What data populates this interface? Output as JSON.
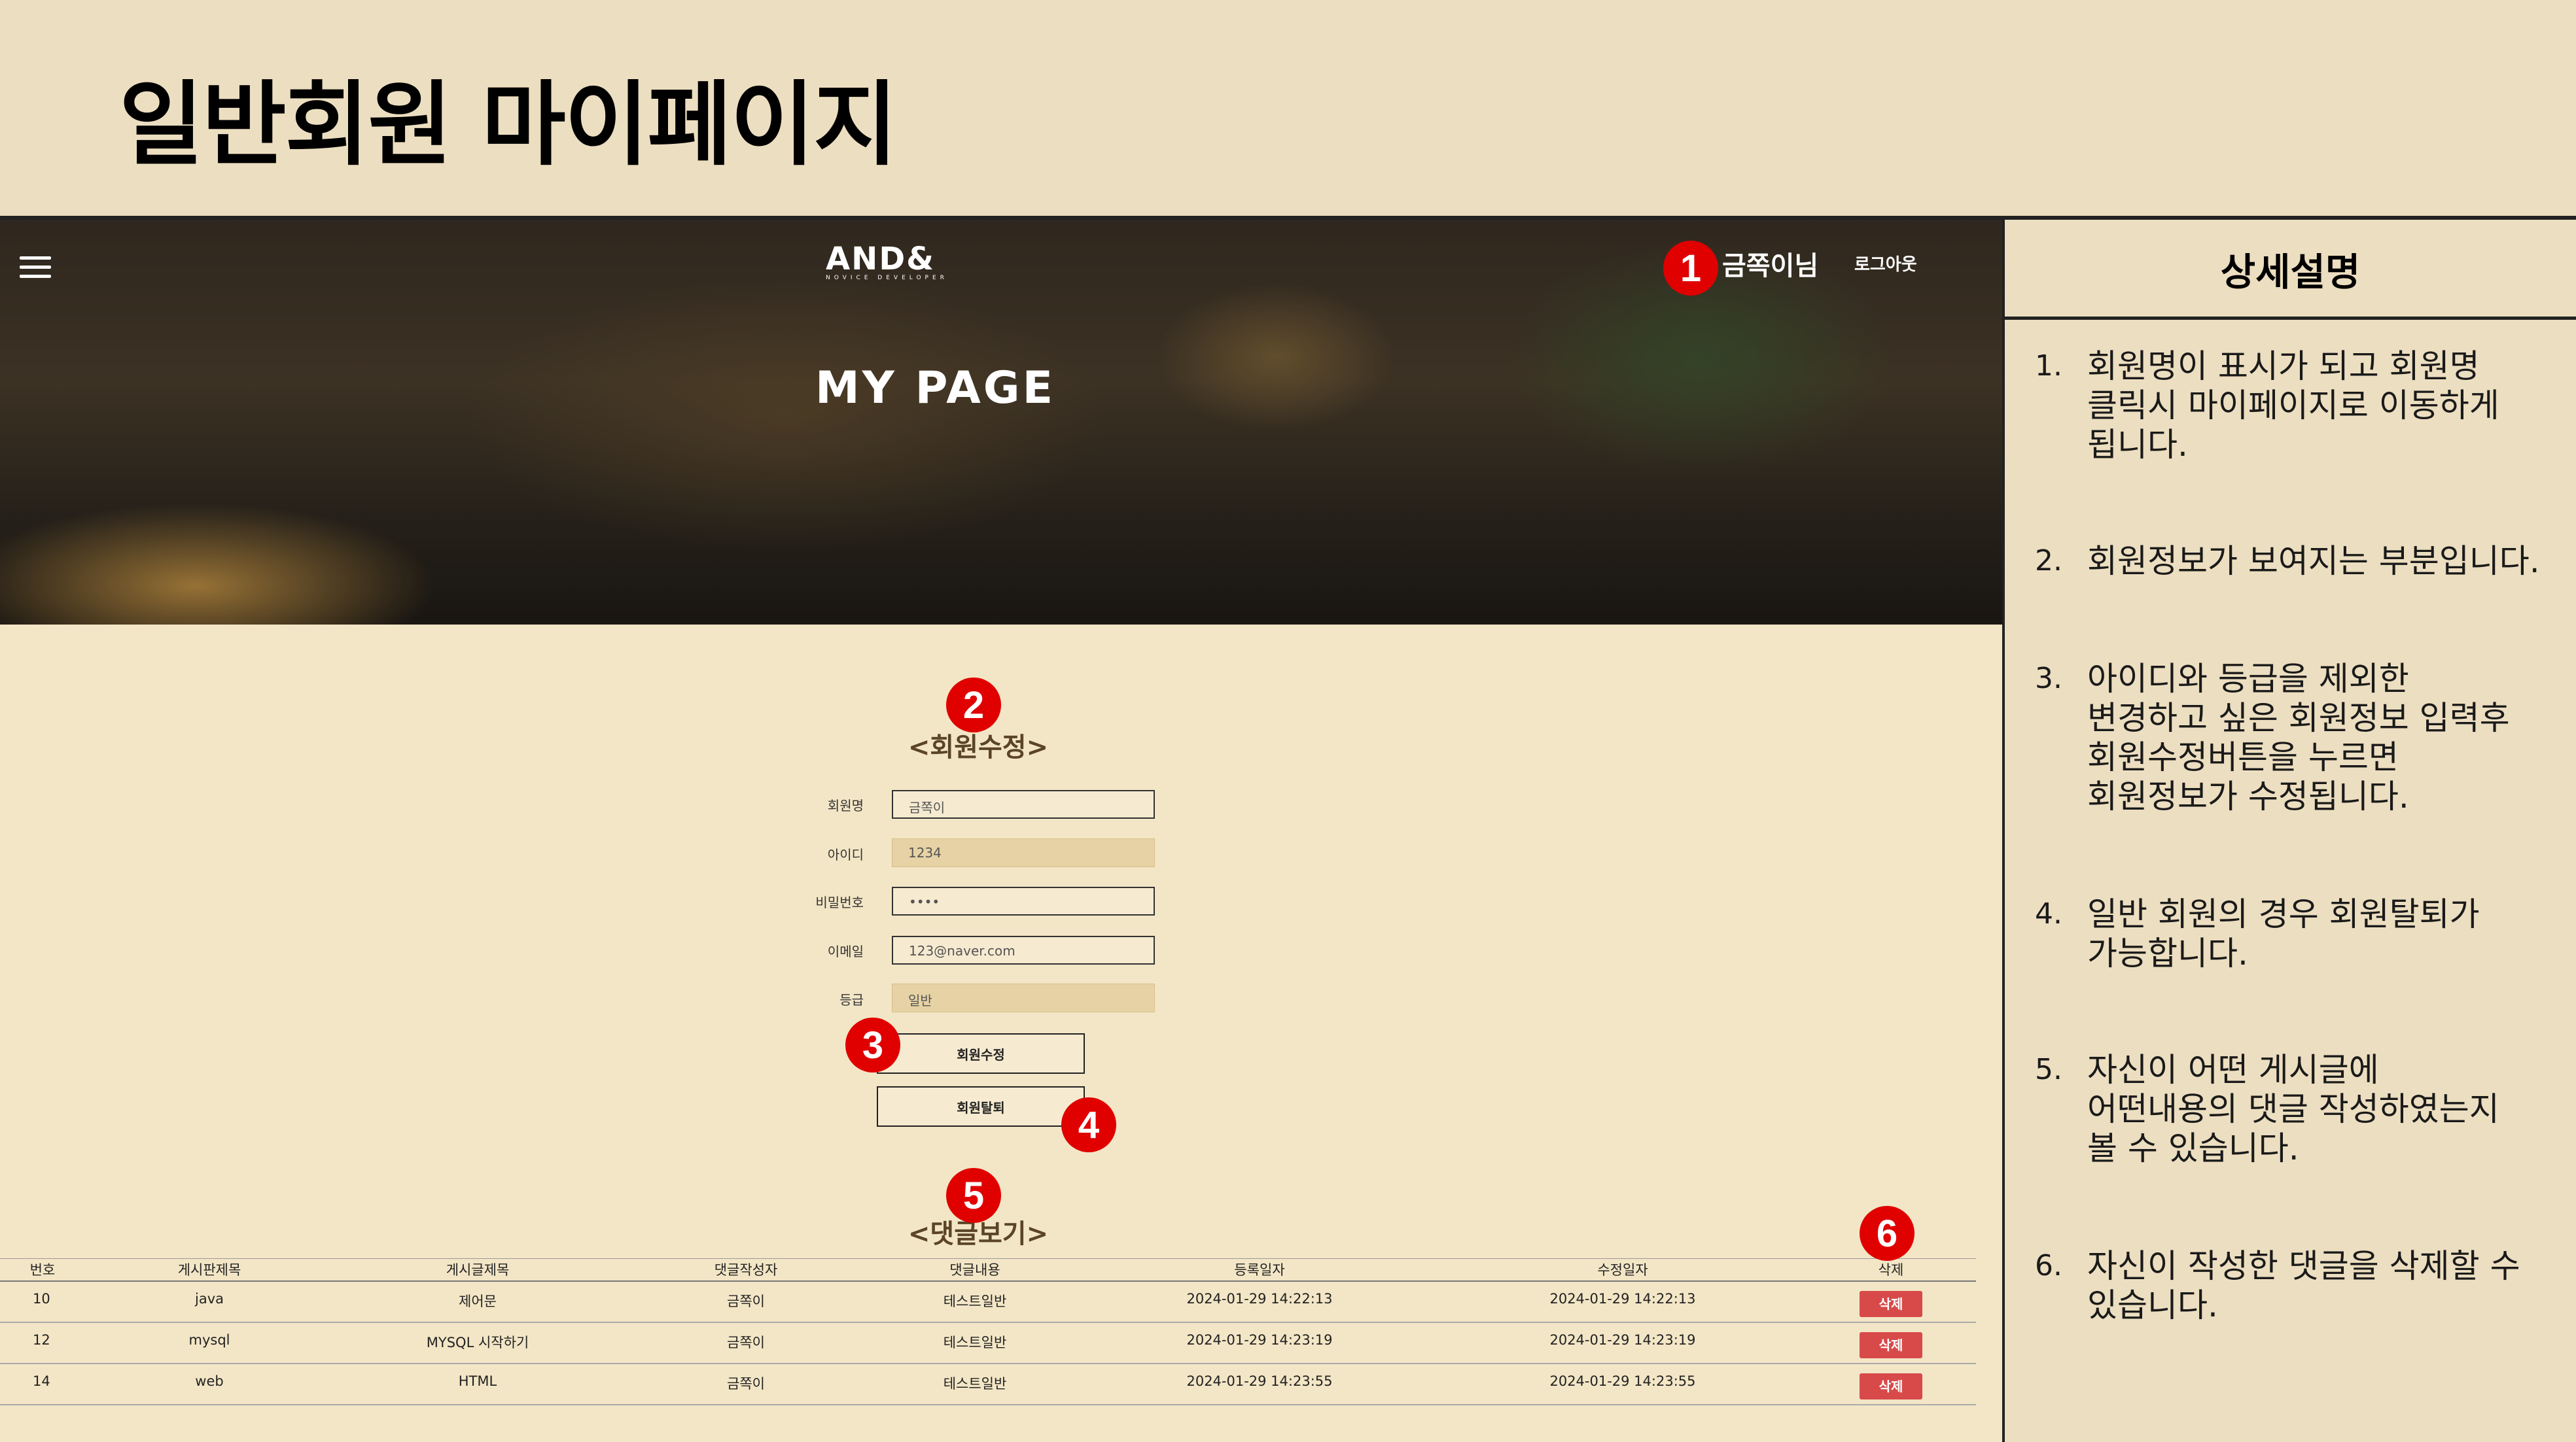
{
  "slide": {
    "title": "일반회원 마이페이지"
  },
  "header": {
    "logo_text": "AND&",
    "logo_subtext": "NOVICE DEVELOPER",
    "hero_title": "MY PAGE",
    "user_name": "금쪽이님",
    "logout_label": "로그아웃"
  },
  "badges": [
    "1",
    "2",
    "3",
    "4",
    "5",
    "6"
  ],
  "member_form": {
    "heading": "<회원수정>",
    "fields": [
      {
        "label": "회원명",
        "value": "금쪽이",
        "readonly": false
      },
      {
        "label": "아이디",
        "value": "1234",
        "readonly": true
      },
      {
        "label": "비밀번호",
        "value": "••••",
        "readonly": false
      },
      {
        "label": "이메일",
        "value": "123@naver.com",
        "readonly": false
      },
      {
        "label": "등급",
        "value": "일반",
        "readonly": true
      }
    ],
    "update_button": "회원수정",
    "withdraw_button": "회원탈퇴"
  },
  "comments": {
    "heading": "<댓글보기>",
    "columns": [
      "번호",
      "게시판제목",
      "게시글제목",
      "댓글작성자",
      "댓글내용",
      "등록일자",
      "수정일자",
      "삭제"
    ],
    "rows": [
      {
        "no": "10",
        "board": "java",
        "post": "제어문",
        "writer": "금쪽이",
        "content": "테스트일반",
        "created": "2024-01-29 14:22:13",
        "updated": "2024-01-29 14:22:13",
        "delete": "삭제"
      },
      {
        "no": "12",
        "board": "mysql",
        "post": "MYSQL 시작하기",
        "writer": "금쪽이",
        "content": "테스트일반",
        "created": "2024-01-29 14:23:19",
        "updated": "2024-01-29 14:23:19",
        "delete": "삭제"
      },
      {
        "no": "14",
        "board": "web",
        "post": "HTML",
        "writer": "금쪽이",
        "content": "테스트일반",
        "created": "2024-01-29 14:23:55",
        "updated": "2024-01-29 14:23:55",
        "delete": "삭제"
      }
    ]
  },
  "details": {
    "title": "상세설명",
    "items": [
      {
        "num": "1.",
        "text": "회원명이 표시가 되고 회원명\n클릭시 마이페이지로 이동하게\n됩니다."
      },
      {
        "num": "2.",
        "text": "회원정보가 보여지는 부분입니다."
      },
      {
        "num": "3.",
        "text": "아이디와 등급을 제외한\n변경하고 싶은 회원정보 입력후\n회원수정버튼을 누르면\n회원정보가 수정됩니다."
      },
      {
        "num": "4.",
        "text": "일반 회원의 경우 회원탈퇴가\n가능합니다."
      },
      {
        "num": "5.",
        "text": "자신이 어떤 게시글에\n어떤내용의 댓글 작성하였는지\n볼 수 있습니다."
      },
      {
        "num": "6.",
        "text": "자신이 작성한 댓글을 삭제할 수\n있습니다."
      }
    ]
  },
  "colors": {
    "background": "#ecdec0",
    "badge": "#e00000",
    "delete_button": "#d84a4a",
    "page_bg": "#f3e6c6"
  }
}
